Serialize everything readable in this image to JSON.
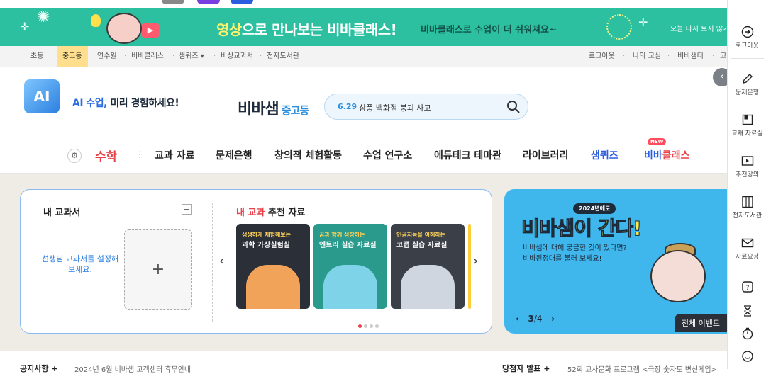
{
  "banner": {
    "headline_highlight": "영상",
    "headline_rest": "으로 만나보는 비바클래스!",
    "sub": "비바클래스로 수업이 더 쉬워져요~",
    "close_today": "오늘 다시 보지 않기",
    "play_symbol": "▶"
  },
  "utilnav": {
    "left": [
      "초등",
      "중고등",
      "연수원",
      "비바클래스",
      "샘퀴즈 ▾",
      "비상교과서",
      "전자도서관"
    ],
    "right": [
      "로그아웃",
      "나의 교실",
      "비바샘터",
      "고"
    ]
  },
  "header": {
    "ai_badge": "AI",
    "ai_text_blue": "AI 수업,",
    "ai_text_rest": " 미리 경험하세요!",
    "logo": "비바샘",
    "logo_level": "중고등",
    "search_date": "6.29",
    "search_keyword": "삼풍 백화점 붕괴 사고",
    "search_icon": "search-icon"
  },
  "mainnav": {
    "gear": "⚙",
    "subject": "수학",
    "items": [
      "교과 자료",
      "문제은행",
      "창의적 체험활동",
      "수업 연구소",
      "에듀테크 테마관",
      "라이브러리"
    ],
    "quiz": "샘퀴즈",
    "viba_a": "비바",
    "viba_b": "클래스",
    "new_badge": "NEW"
  },
  "mytextbook": {
    "title": "내 교과서",
    "add_small": "+",
    "hint": "선생님 교과서를 설정해 보세요.",
    "add_big": "+"
  },
  "recommend": {
    "title_red": "내 교과",
    "title_rest": " 추천 자료",
    "prev": "‹",
    "next": "›",
    "cards": [
      {
        "cap1": "생생하게 체험해보는",
        "cap2": "과학 가상실험실",
        "bg": "#2a2f38",
        "art": "#f2a35a"
      },
      {
        "cap1": "꿈과 함께 성장하는",
        "cap2": "엔트리 실습 자료실",
        "bg": "#2a9a8c",
        "art": "#7fd3e8"
      },
      {
        "cap1": "인공지능을 이해하는",
        "cap2": "코랩 실습 자료실",
        "bg": "#3a3f48",
        "art": "#cfd6df"
      }
    ],
    "partial_bg": "#ffcc3a"
  },
  "event": {
    "pill": "2024년에도",
    "big": "비바샘이 간다!",
    "desc1": "비바샘에 대해 궁금한 것이 있다면?",
    "desc2": "비바원정대를 불러 보세요!",
    "page_current": "3",
    "page_total": "/4",
    "prev": "‹",
    "next": "›",
    "all": "전체 이벤트"
  },
  "bottom": {
    "notice": "공지사항 +",
    "notice_text": "2024년 6월 비바샘 고객센터 휴무안내",
    "winner": "당첨자 발표 +",
    "winner_text": "52회 교사문화 프로그램 <극장 숫자도 변신게임>"
  },
  "quickbar": [
    {
      "label": "로그아웃",
      "icon": "logout-icon"
    },
    {
      "label": "문제은행",
      "icon": "pencil-icon"
    },
    {
      "label": "교재 자료실",
      "icon": "book-icon"
    },
    {
      "label": "추천강의",
      "icon": "play-icon"
    },
    {
      "label": "전자도서관",
      "icon": "library-icon"
    },
    {
      "label": "자료요청",
      "icon": "mail-icon"
    }
  ],
  "collapse": "‹"
}
